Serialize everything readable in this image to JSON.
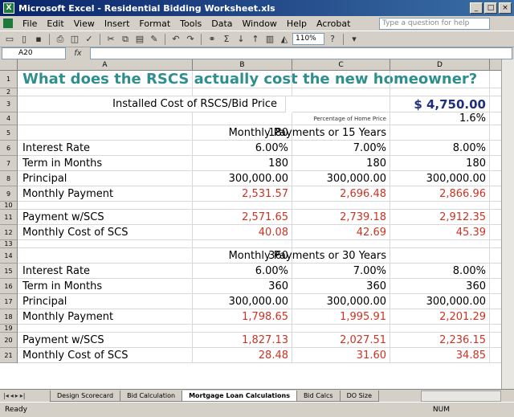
{
  "window": {
    "title": "Microsoft Excel - Residential Bidding Worksheet.xls",
    "app_icon": "excel-icon"
  },
  "menu": [
    "File",
    "Edit",
    "View",
    "Insert",
    "Format",
    "Tools",
    "Data",
    "Window",
    "Help",
    "Acrobat"
  ],
  "help_placeholder": "Type a question for help",
  "zoom": "110%",
  "namebox": "A20",
  "columns": [
    "A",
    "B",
    "C",
    "D"
  ],
  "rows": [
    {
      "n": "1",
      "a": "What does the RSCS actually cost the new homeowner?",
      "b": "",
      "c": "",
      "d": ""
    },
    {
      "n": "2",
      "a": "",
      "b": "",
      "c": "",
      "d": ""
    },
    {
      "n": "3",
      "a": "Installed Cost of RSCS/Bid Price",
      "b": "",
      "c": "",
      "d": "$ 4,750.00"
    },
    {
      "n": "4",
      "a": "",
      "b": "",
      "c": "Percentage of Home Price",
      "d": "1.6%"
    },
    {
      "n": "5",
      "a": "",
      "b": "180",
      "c": "Monthly Payments or 15 Years",
      "d": ""
    },
    {
      "n": "6",
      "a": "Interest Rate",
      "b": "6.00%",
      "c": "7.00%",
      "d": "8.00%"
    },
    {
      "n": "7",
      "a": "Term in Months",
      "b": "180",
      "c": "180",
      "d": "180"
    },
    {
      "n": "8",
      "a": "Principal",
      "b": "300,000.00",
      "c": "300,000.00",
      "d": "300,000.00"
    },
    {
      "n": "9",
      "a": "Monthly Payment",
      "b": "2,531.57",
      "c": "2,696.48",
      "d": "2,866.96",
      "red": true
    },
    {
      "n": "10",
      "a": "",
      "b": "",
      "c": "",
      "d": ""
    },
    {
      "n": "11",
      "a": "Payment w/SCS",
      "b": "2,571.65",
      "c": "2,739.18",
      "d": "2,912.35",
      "red": true
    },
    {
      "n": "12",
      "a": "Monthly Cost of SCS",
      "b": "40.08",
      "c": "42.69",
      "d": "45.39",
      "red": true
    },
    {
      "n": "13",
      "a": "",
      "b": "",
      "c": "",
      "d": ""
    },
    {
      "n": "14",
      "a": "",
      "b": "360",
      "c": "Monthly Payments or 30 Years",
      "d": ""
    },
    {
      "n": "15",
      "a": "Interest Rate",
      "b": "6.00%",
      "c": "7.00%",
      "d": "8.00%"
    },
    {
      "n": "16",
      "a": "Term in Months",
      "b": "360",
      "c": "360",
      "d": "360"
    },
    {
      "n": "17",
      "a": "Principal",
      "b": "300,000.00",
      "c": "300,000.00",
      "d": "300,000.00"
    },
    {
      "n": "18",
      "a": "Monthly Payment",
      "b": "1,798.65",
      "c": "1,995.91",
      "d": "2,201.29",
      "red": true
    },
    {
      "n": "19",
      "a": "",
      "b": "",
      "c": "",
      "d": ""
    },
    {
      "n": "20",
      "a": "Payment w/SCS",
      "b": "1,827.13",
      "c": "2,027.51",
      "d": "2,236.15",
      "red": true
    },
    {
      "n": "21",
      "a": "Monthly Cost of SCS",
      "b": "28.48",
      "c": "31.60",
      "d": "34.85",
      "red": true
    }
  ],
  "sheet_tabs": [
    "Design Scorecard",
    "Bid Calculation",
    "Mortgage Loan Calculations",
    "Bid Calcs",
    "DO Size"
  ],
  "active_tab": 2,
  "status": {
    "left": "Ready",
    "right": "NUM"
  }
}
